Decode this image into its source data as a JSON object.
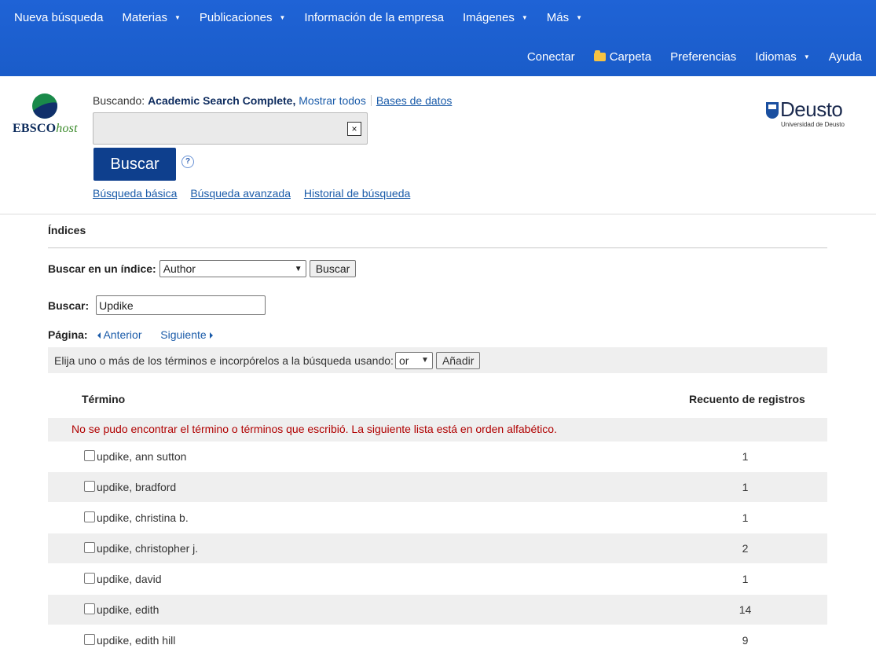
{
  "topnav": {
    "row1": [
      {
        "label": "Nueva búsqueda",
        "caret": false
      },
      {
        "label": "Materias",
        "caret": true
      },
      {
        "label": "Publicaciones",
        "caret": true
      },
      {
        "label": "Información de la empresa",
        "caret": false
      },
      {
        "label": "Imágenes",
        "caret": true
      },
      {
        "label": "Más",
        "caret": true
      }
    ],
    "row2": {
      "conectar": "Conectar",
      "carpeta": "Carpeta",
      "preferencias": "Preferencias",
      "idiomas": "Idiomas",
      "ayuda": "Ayuda"
    }
  },
  "logo": {
    "brand": "EBSCO",
    "suffix": "host"
  },
  "search": {
    "searching_label": "Buscando:",
    "database": "Academic Search Complete,",
    "show_all": "Mostrar todos",
    "databases_link": "Bases de datos",
    "query": "",
    "clear": "×",
    "button": "Buscar",
    "help": "?",
    "links": [
      "Búsqueda básica",
      "Búsqueda avanzada",
      "Historial de búsqueda"
    ]
  },
  "institution": {
    "name": "Deusto",
    "sub": "Universidad de Deusto"
  },
  "main": {
    "title": "Índices",
    "index_label": "Buscar en un índice:",
    "index_selected": "Author",
    "index_button": "Buscar",
    "term_label": "Buscar:",
    "term_value": "Updike",
    "page_label": "Página:",
    "prev": "Anterior",
    "next": "Siguiente",
    "choose_text": "Elija uno o más de los términos e incorpórelos a la búsqueda usando:",
    "operator": "or",
    "add_button": "Añadir",
    "col_term": "Término",
    "col_count": "Recuento de registros",
    "notice": "No se pudo encontrar el término o términos que escribió. La siguiente lista está en orden alfabético.",
    "rows": [
      {
        "term": "updike, ann sutton",
        "count": "1"
      },
      {
        "term": "updike, bradford",
        "count": "1"
      },
      {
        "term": "updike, christina b.",
        "count": "1"
      },
      {
        "term": "updike, christopher j.",
        "count": "2"
      },
      {
        "term": "updike, david",
        "count": "1"
      },
      {
        "term": "updike, edith",
        "count": "14"
      },
      {
        "term": "updike, edith hill",
        "count": "9"
      }
    ]
  },
  "colors": {
    "nav": "#1f63d6",
    "button": "#0e3f8d",
    "link": "#1a5ba9",
    "notice": "#b00000"
  }
}
